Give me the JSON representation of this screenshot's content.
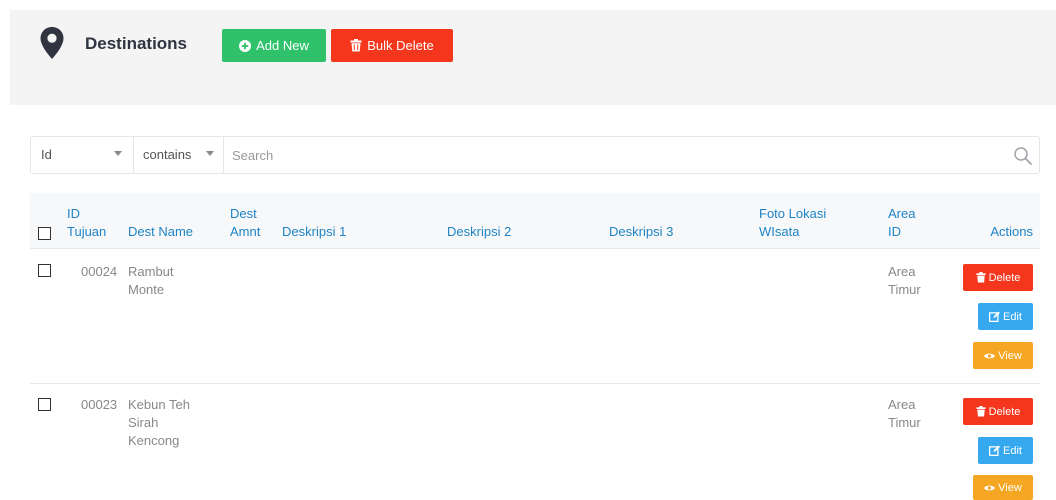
{
  "header": {
    "title": "Destinations",
    "add_label": "Add New",
    "bulk_delete_label": "Bulk Delete"
  },
  "colors": {
    "header_band": "#f4f4f5",
    "add_button": "#2fc26b",
    "delete_button": "#f4361c",
    "edit_button": "#35a8ef",
    "view_button": "#f5a623",
    "column_header_text": "#1f84c6"
  },
  "search": {
    "field": "Id",
    "operator": "contains",
    "placeholder": "Search"
  },
  "table": {
    "columns": {
      "id_line1": "ID",
      "id_line2": "Tujuan",
      "dest_name": "Dest Name",
      "dest_amnt_line1": "Dest",
      "dest_amnt_line2": "Amnt",
      "deskripsi1": "Deskripsi 1",
      "deskripsi2": "Deskripsi 2",
      "deskripsi3": "Deskripsi 3",
      "foto_line1": "Foto Lokasi",
      "foto_line2": "WIsata",
      "area_line1": "Area",
      "area_line2": "ID",
      "actions": "Actions"
    },
    "rows": [
      {
        "id": "00024",
        "name_line1": "Rambut",
        "name_line2": "Monte",
        "area_line1": "Area",
        "area_line2": "Timur",
        "delete_label": "Delete",
        "edit_label": "Edit",
        "view_label": "View"
      },
      {
        "id": "00023",
        "name_line1": "Kebun Teh",
        "name_line2": "Sirah",
        "name_line3": "Kencong",
        "area_line1": "Area",
        "area_line2": "Timur",
        "delete_label": "Delete",
        "edit_label": "Edit",
        "view_label": "View"
      }
    ]
  },
  "icons": {
    "page": "map-marker-icon",
    "add": "plus-circle-icon",
    "bulk_delete": "trash-icon",
    "search": "magnifier-icon",
    "edit": "pencil-square-icon",
    "view": "eye-icon"
  }
}
